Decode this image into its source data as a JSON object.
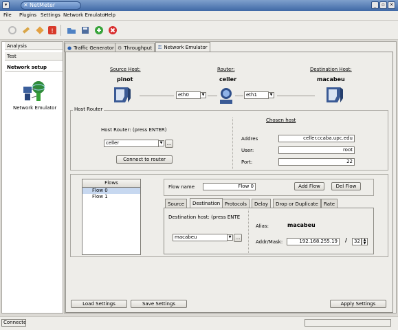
{
  "window": {
    "title": "NetMeter"
  },
  "menu": [
    "File",
    "Plugins",
    "Settings",
    "Network Emulator",
    "Help"
  ],
  "left": {
    "tabs": [
      "Analysis",
      "Test",
      "Network setup"
    ],
    "item_label": "Network Emulator"
  },
  "tabs": [
    "Traffic Generator",
    "Throughput",
    "Network Emulator"
  ],
  "topology": {
    "source_label": "Source Host:",
    "source_name": "pinot",
    "router_label": "Router:",
    "router_name": "celler",
    "dest_label": "Destination Host:",
    "dest_name": "macabeu",
    "iface_left": "eth0",
    "iface_right": "eth1"
  },
  "host_router": {
    "title": "Host Router",
    "prompt": "Host Router: (press ENTER)",
    "router_value": "celler",
    "more": "...",
    "connect": "Connect to router",
    "chosen_title": "Chosen host",
    "address_label": "Addres",
    "address_value": "celler.ccaba.upc.edu",
    "user_label": "User:",
    "user_value": "root",
    "port_label": "Port:",
    "port_value": "22"
  },
  "flows": {
    "header": "Flows",
    "items": [
      "Flow 0",
      "Flow 1"
    ],
    "flow_name_label": "Flow name",
    "flow_name_value": "Flow 0",
    "add": "Add Flow",
    "del": "Del Flow"
  },
  "subtabs": [
    "Source",
    "Destination",
    "Protocols",
    "Delay",
    "Drop or Duplicate",
    "Rate"
  ],
  "dest": {
    "prompt": "Destination host: (press ENTE",
    "host_value": "macabeu",
    "more": "...",
    "alias_label": "Alias:",
    "alias_value": "macabeu",
    "addr_label": "Addr/Mask:",
    "addr_value": "192.168.255.19",
    "slash": "/",
    "mask_value": "32"
  },
  "buttons": {
    "load": "Load Settings",
    "save": "Save Settings",
    "apply": "Apply Settings"
  },
  "status": {
    "text": "Connected"
  },
  "colors": {
    "title_bar": "#3f68a6",
    "selection": "#c7d8f0"
  }
}
